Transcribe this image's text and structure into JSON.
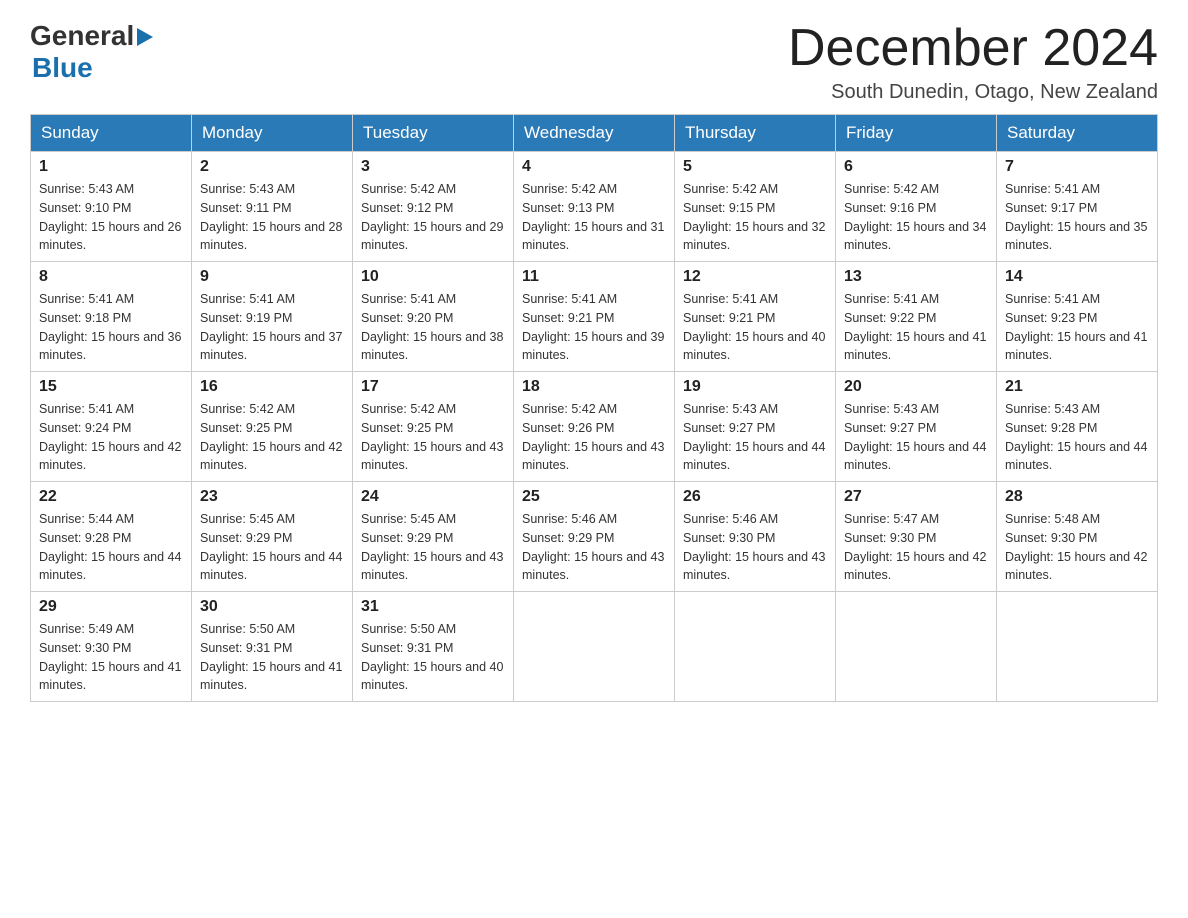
{
  "logo": {
    "general": "General",
    "arrow": "▶",
    "blue": "Blue"
  },
  "title": "December 2024",
  "subtitle": "South Dunedin, Otago, New Zealand",
  "days_of_week": [
    "Sunday",
    "Monday",
    "Tuesday",
    "Wednesday",
    "Thursday",
    "Friday",
    "Saturday"
  ],
  "weeks": [
    [
      {
        "day": "1",
        "sunrise": "5:43 AM",
        "sunset": "9:10 PM",
        "daylight": "15 hours and 26 minutes."
      },
      {
        "day": "2",
        "sunrise": "5:43 AM",
        "sunset": "9:11 PM",
        "daylight": "15 hours and 28 minutes."
      },
      {
        "day": "3",
        "sunrise": "5:42 AM",
        "sunset": "9:12 PM",
        "daylight": "15 hours and 29 minutes."
      },
      {
        "day": "4",
        "sunrise": "5:42 AM",
        "sunset": "9:13 PM",
        "daylight": "15 hours and 31 minutes."
      },
      {
        "day": "5",
        "sunrise": "5:42 AM",
        "sunset": "9:15 PM",
        "daylight": "15 hours and 32 minutes."
      },
      {
        "day": "6",
        "sunrise": "5:42 AM",
        "sunset": "9:16 PM",
        "daylight": "15 hours and 34 minutes."
      },
      {
        "day": "7",
        "sunrise": "5:41 AM",
        "sunset": "9:17 PM",
        "daylight": "15 hours and 35 minutes."
      }
    ],
    [
      {
        "day": "8",
        "sunrise": "5:41 AM",
        "sunset": "9:18 PM",
        "daylight": "15 hours and 36 minutes."
      },
      {
        "day": "9",
        "sunrise": "5:41 AM",
        "sunset": "9:19 PM",
        "daylight": "15 hours and 37 minutes."
      },
      {
        "day": "10",
        "sunrise": "5:41 AM",
        "sunset": "9:20 PM",
        "daylight": "15 hours and 38 minutes."
      },
      {
        "day": "11",
        "sunrise": "5:41 AM",
        "sunset": "9:21 PM",
        "daylight": "15 hours and 39 minutes."
      },
      {
        "day": "12",
        "sunrise": "5:41 AM",
        "sunset": "9:21 PM",
        "daylight": "15 hours and 40 minutes."
      },
      {
        "day": "13",
        "sunrise": "5:41 AM",
        "sunset": "9:22 PM",
        "daylight": "15 hours and 41 minutes."
      },
      {
        "day": "14",
        "sunrise": "5:41 AM",
        "sunset": "9:23 PM",
        "daylight": "15 hours and 41 minutes."
      }
    ],
    [
      {
        "day": "15",
        "sunrise": "5:41 AM",
        "sunset": "9:24 PM",
        "daylight": "15 hours and 42 minutes."
      },
      {
        "day": "16",
        "sunrise": "5:42 AM",
        "sunset": "9:25 PM",
        "daylight": "15 hours and 42 minutes."
      },
      {
        "day": "17",
        "sunrise": "5:42 AM",
        "sunset": "9:25 PM",
        "daylight": "15 hours and 43 minutes."
      },
      {
        "day": "18",
        "sunrise": "5:42 AM",
        "sunset": "9:26 PM",
        "daylight": "15 hours and 43 minutes."
      },
      {
        "day": "19",
        "sunrise": "5:43 AM",
        "sunset": "9:27 PM",
        "daylight": "15 hours and 44 minutes."
      },
      {
        "day": "20",
        "sunrise": "5:43 AM",
        "sunset": "9:27 PM",
        "daylight": "15 hours and 44 minutes."
      },
      {
        "day": "21",
        "sunrise": "5:43 AM",
        "sunset": "9:28 PM",
        "daylight": "15 hours and 44 minutes."
      }
    ],
    [
      {
        "day": "22",
        "sunrise": "5:44 AM",
        "sunset": "9:28 PM",
        "daylight": "15 hours and 44 minutes."
      },
      {
        "day": "23",
        "sunrise": "5:45 AM",
        "sunset": "9:29 PM",
        "daylight": "15 hours and 44 minutes."
      },
      {
        "day": "24",
        "sunrise": "5:45 AM",
        "sunset": "9:29 PM",
        "daylight": "15 hours and 43 minutes."
      },
      {
        "day": "25",
        "sunrise": "5:46 AM",
        "sunset": "9:29 PM",
        "daylight": "15 hours and 43 minutes."
      },
      {
        "day": "26",
        "sunrise": "5:46 AM",
        "sunset": "9:30 PM",
        "daylight": "15 hours and 43 minutes."
      },
      {
        "day": "27",
        "sunrise": "5:47 AM",
        "sunset": "9:30 PM",
        "daylight": "15 hours and 42 minutes."
      },
      {
        "day": "28",
        "sunrise": "5:48 AM",
        "sunset": "9:30 PM",
        "daylight": "15 hours and 42 minutes."
      }
    ],
    [
      {
        "day": "29",
        "sunrise": "5:49 AM",
        "sunset": "9:30 PM",
        "daylight": "15 hours and 41 minutes."
      },
      {
        "day": "30",
        "sunrise": "5:50 AM",
        "sunset": "9:31 PM",
        "daylight": "15 hours and 41 minutes."
      },
      {
        "day": "31",
        "sunrise": "5:50 AM",
        "sunset": "9:31 PM",
        "daylight": "15 hours and 40 minutes."
      },
      null,
      null,
      null,
      null
    ]
  ],
  "labels": {
    "sunrise": "Sunrise:",
    "sunset": "Sunset:",
    "daylight": "Daylight:"
  }
}
